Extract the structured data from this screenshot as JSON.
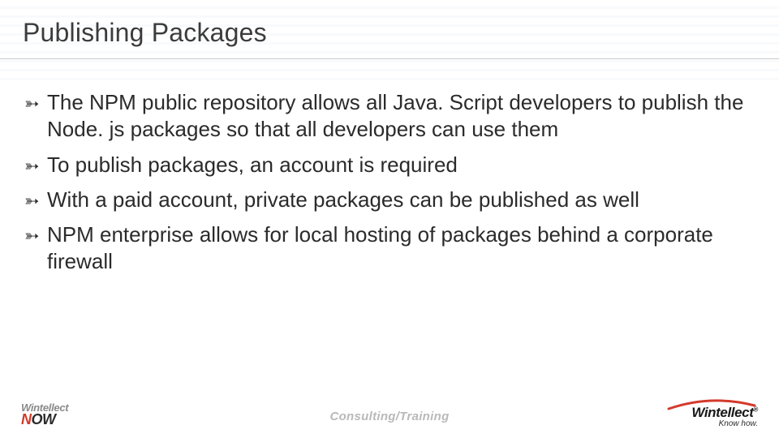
{
  "title": "Publishing Packages",
  "bullets": [
    "The NPM public repository allows all Java. Script developers to publish the Node. js packages so that all developers can use them",
    "To publish packages, an account is required",
    "With a paid account, private packages can be published as well",
    "NPM enterprise allows for local hosting of packages behind a corporate firewall"
  ],
  "footer": {
    "center": "Consulting/Training",
    "left_logo": {
      "line1": "Wintellect",
      "line2_part1": "N",
      "line2_part2": "OW"
    },
    "right_logo": {
      "brand": "Wintellect",
      "reg": "®",
      "tagline": "Know how."
    }
  }
}
